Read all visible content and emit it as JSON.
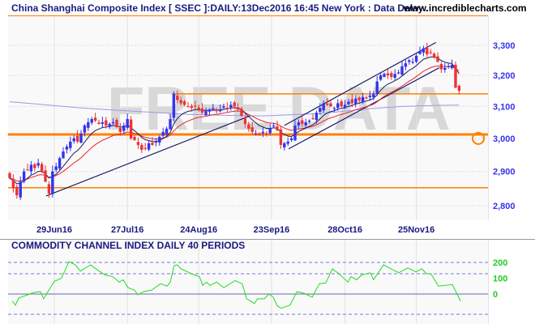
{
  "header": {
    "title": "China Shanghai Composite Index [ SSEC ]:DAILY:13Dec2016 16:45 New York : Data Delay..",
    "site": "www.incrediblecharts.com"
  },
  "watermark": "FREE DATA",
  "colors": {
    "up": "#3333ee",
    "down": "#ee3333",
    "orange": "#ff8000",
    "ma_fast": "#1a1a60",
    "ma_slow": "#ee2222",
    "ma_long": "#9999ee",
    "cci": "#22dd22",
    "trend": "#1a1a70"
  },
  "chart_data": [
    {
      "type": "candlestick",
      "title": "China Shanghai Composite Index [ SSEC ] DAILY",
      "yscale": "log",
      "ylim": [
        2770,
        3340
      ],
      "y_ticks": [
        {
          "v": 3300,
          "label": "3,300"
        },
        {
          "v": 3200,
          "label": "3,200"
        },
        {
          "v": 3100,
          "label": "3,100"
        },
        {
          "v": 3000,
          "label": "3,000"
        },
        {
          "v": 2900,
          "label": "2,900"
        },
        {
          "v": 2800,
          "label": "2,800"
        }
      ],
      "x_ticks": [
        {
          "i": 12.5,
          "label": "29Jun16"
        },
        {
          "i": 33,
          "label": "27Jul16"
        },
        {
          "i": 53,
          "label": "24Aug16"
        },
        {
          "i": 73.4,
          "label": "23Sep16"
        },
        {
          "i": 94,
          "label": "28Oct16"
        },
        {
          "i": 114,
          "label": "25Nov16"
        }
      ],
      "close": [
        2880,
        2850,
        2830,
        2870,
        2900,
        2905,
        2920,
        2910,
        2925,
        2900,
        2870,
        2835,
        2900,
        2915,
        2940,
        2960,
        2975,
        2990,
        3000,
        2990,
        3015,
        3040,
        3050,
        3060,
        3055,
        3045,
        3050,
        3040,
        3045,
        3050,
        3035,
        3020,
        3040,
        3060,
        3000,
        2995,
        2980,
        2965,
        2970,
        2985,
        2980,
        2990,
        3005,
        3020,
        3030,
        3060,
        3140,
        3120,
        3110,
        3105,
        3100,
        3095,
        3100,
        3090,
        3080,
        3085,
        3090,
        3095,
        3085,
        3090,
        3100,
        3095,
        3105,
        3100,
        3090,
        3070,
        3045,
        3030,
        3020,
        3015,
        3010,
        3020,
        3015,
        3030,
        3040,
        3025,
        2980,
        2985,
        2990,
        3000,
        3040,
        3050,
        3045,
        3050,
        3055,
        3060,
        3080,
        3095,
        3110,
        3105,
        3100,
        3095,
        3110,
        3100,
        3105,
        3115,
        3110,
        3125,
        3120,
        3130,
        3125,
        3135,
        3140,
        3180,
        3200,
        3205,
        3200,
        3195,
        3205,
        3210,
        3230,
        3240,
        3250,
        3245,
        3265,
        3280,
        3290,
        3270,
        3275,
        3260,
        3245,
        3220,
        3225,
        3230,
        3235,
        3160,
        3150
      ],
      "ma_long_points": [
        [
          0,
          3115
        ],
        [
          20,
          3095
        ],
        [
          34,
          3085
        ],
        [
          50,
          3075
        ],
        [
          66,
          3070
        ],
        [
          72,
          3070
        ],
        [
          88,
          3078
        ],
        [
          100,
          3092
        ],
        [
          110,
          3100
        ],
        [
          120,
          3103
        ],
        [
          126,
          3104
        ]
      ],
      "horizontal_levels": [
        {
          "v": 3140,
          "from_i": 45.5,
          "weight": "thin"
        },
        {
          "v": 3012,
          "from_i": -0.5,
          "weight": "thick"
        },
        {
          "v": 2852,
          "from_i": -0.5,
          "weight": "thin"
        }
      ],
      "trendlines": [
        {
          "from": [
            10.2,
            2828
          ],
          "to": [
            67.3,
            3070
          ]
        },
        {
          "from": [
            77,
            3040
          ],
          "to": [
            119.5,
            3310
          ]
        },
        {
          "from": [
            78.2,
            2968
          ],
          "to": [
            120.4,
            3225
          ]
        }
      ],
      "marker_circle": {
        "v": 3000
      }
    },
    {
      "type": "line",
      "title": "COMMODITY CHANNEL INDEX DAILY 40 PERIODS",
      "ylim": [
        -160,
        280
      ],
      "y_ticks": [
        {
          "v": 200,
          "label": "200"
        },
        {
          "v": 100,
          "label": "100"
        },
        {
          "v": 0,
          "label": "0"
        }
      ],
      "levels": [
        200,
        128,
        0,
        -128
      ],
      "points": [
        [
          0.7,
          -45
        ],
        [
          1.6,
          -70
        ],
        [
          2.5,
          -25
        ],
        [
          5,
          -5
        ],
        [
          6.8,
          10
        ],
        [
          8.6,
          15
        ],
        [
          9.5,
          -30
        ],
        [
          10.7,
          15
        ],
        [
          12.5,
          80
        ],
        [
          14.5,
          100
        ],
        [
          16.6,
          205
        ],
        [
          18.4,
          185
        ],
        [
          19.8,
          145
        ],
        [
          22.7,
          185
        ],
        [
          24.1,
          160
        ],
        [
          26.8,
          120
        ],
        [
          28.9,
          110
        ],
        [
          30.7,
          75
        ],
        [
          31.8,
          90
        ],
        [
          33.2,
          40
        ],
        [
          35,
          25
        ],
        [
          35.9,
          -5
        ],
        [
          37.5,
          15
        ],
        [
          39.8,
          25
        ],
        [
          42.3,
          65
        ],
        [
          44.1,
          50
        ],
        [
          45,
          75
        ],
        [
          46.1,
          180
        ],
        [
          47,
          185
        ],
        [
          48,
          160
        ],
        [
          51.8,
          120
        ],
        [
          53.2,
          110
        ],
        [
          54.1,
          55
        ],
        [
          55.2,
          75
        ],
        [
          56.1,
          55
        ],
        [
          58,
          75
        ],
        [
          60,
          40
        ],
        [
          63.2,
          85
        ],
        [
          65.2,
          65
        ],
        [
          66.4,
          -30
        ],
        [
          68.6,
          -60
        ],
        [
          69.5,
          -30
        ],
        [
          71.4,
          -30
        ],
        [
          72.7,
          0
        ],
        [
          73.9,
          -20
        ],
        [
          75,
          -75
        ],
        [
          76.1,
          -90
        ],
        [
          78.6,
          -70
        ],
        [
          80.5,
          15
        ],
        [
          82.5,
          5
        ],
        [
          84.8,
          -20
        ],
        [
          86.8,
          65
        ],
        [
          88.6,
          70
        ],
        [
          90.5,
          160
        ],
        [
          93,
          115
        ],
        [
          94.8,
          75
        ],
        [
          95.7,
          110
        ],
        [
          97.3,
          90
        ],
        [
          98.6,
          120
        ],
        [
          101.1,
          135
        ],
        [
          102,
          90
        ],
        [
          104.8,
          185
        ],
        [
          107.3,
          155
        ],
        [
          109.1,
          135
        ],
        [
          111.6,
          165
        ],
        [
          113.9,
          140
        ],
        [
          115.5,
          160
        ],
        [
          116.8,
          130
        ],
        [
          118.2,
          125
        ],
        [
          120.2,
          50
        ],
        [
          124.1,
          60
        ],
        [
          126.4,
          -45
        ]
      ]
    }
  ]
}
